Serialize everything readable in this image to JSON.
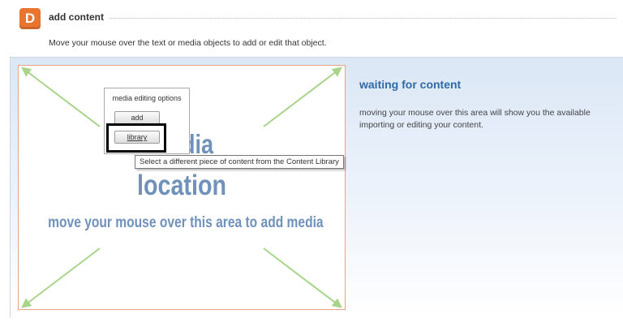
{
  "step": {
    "badge": "D",
    "title": "add content"
  },
  "instruction": "Move your mouse over the text or media objects to add or edit that object.",
  "media_area": {
    "word1": "media",
    "word2": "location",
    "hint": "move your mouse over this area to add media"
  },
  "options": {
    "title": "media editing options",
    "add_label": "add",
    "library_label": "library"
  },
  "tooltip": "Select a different piece of content from the Content Library",
  "waiting": {
    "title": "waiting for content",
    "line1": "moving your mouse over this area will show you the available",
    "line2": "importing or editing your content."
  },
  "colors": {
    "badge": "#e8742f",
    "media_text": "#6f91ba",
    "arrows": "#a8d48a",
    "waiting_title": "#2e6aa8"
  }
}
